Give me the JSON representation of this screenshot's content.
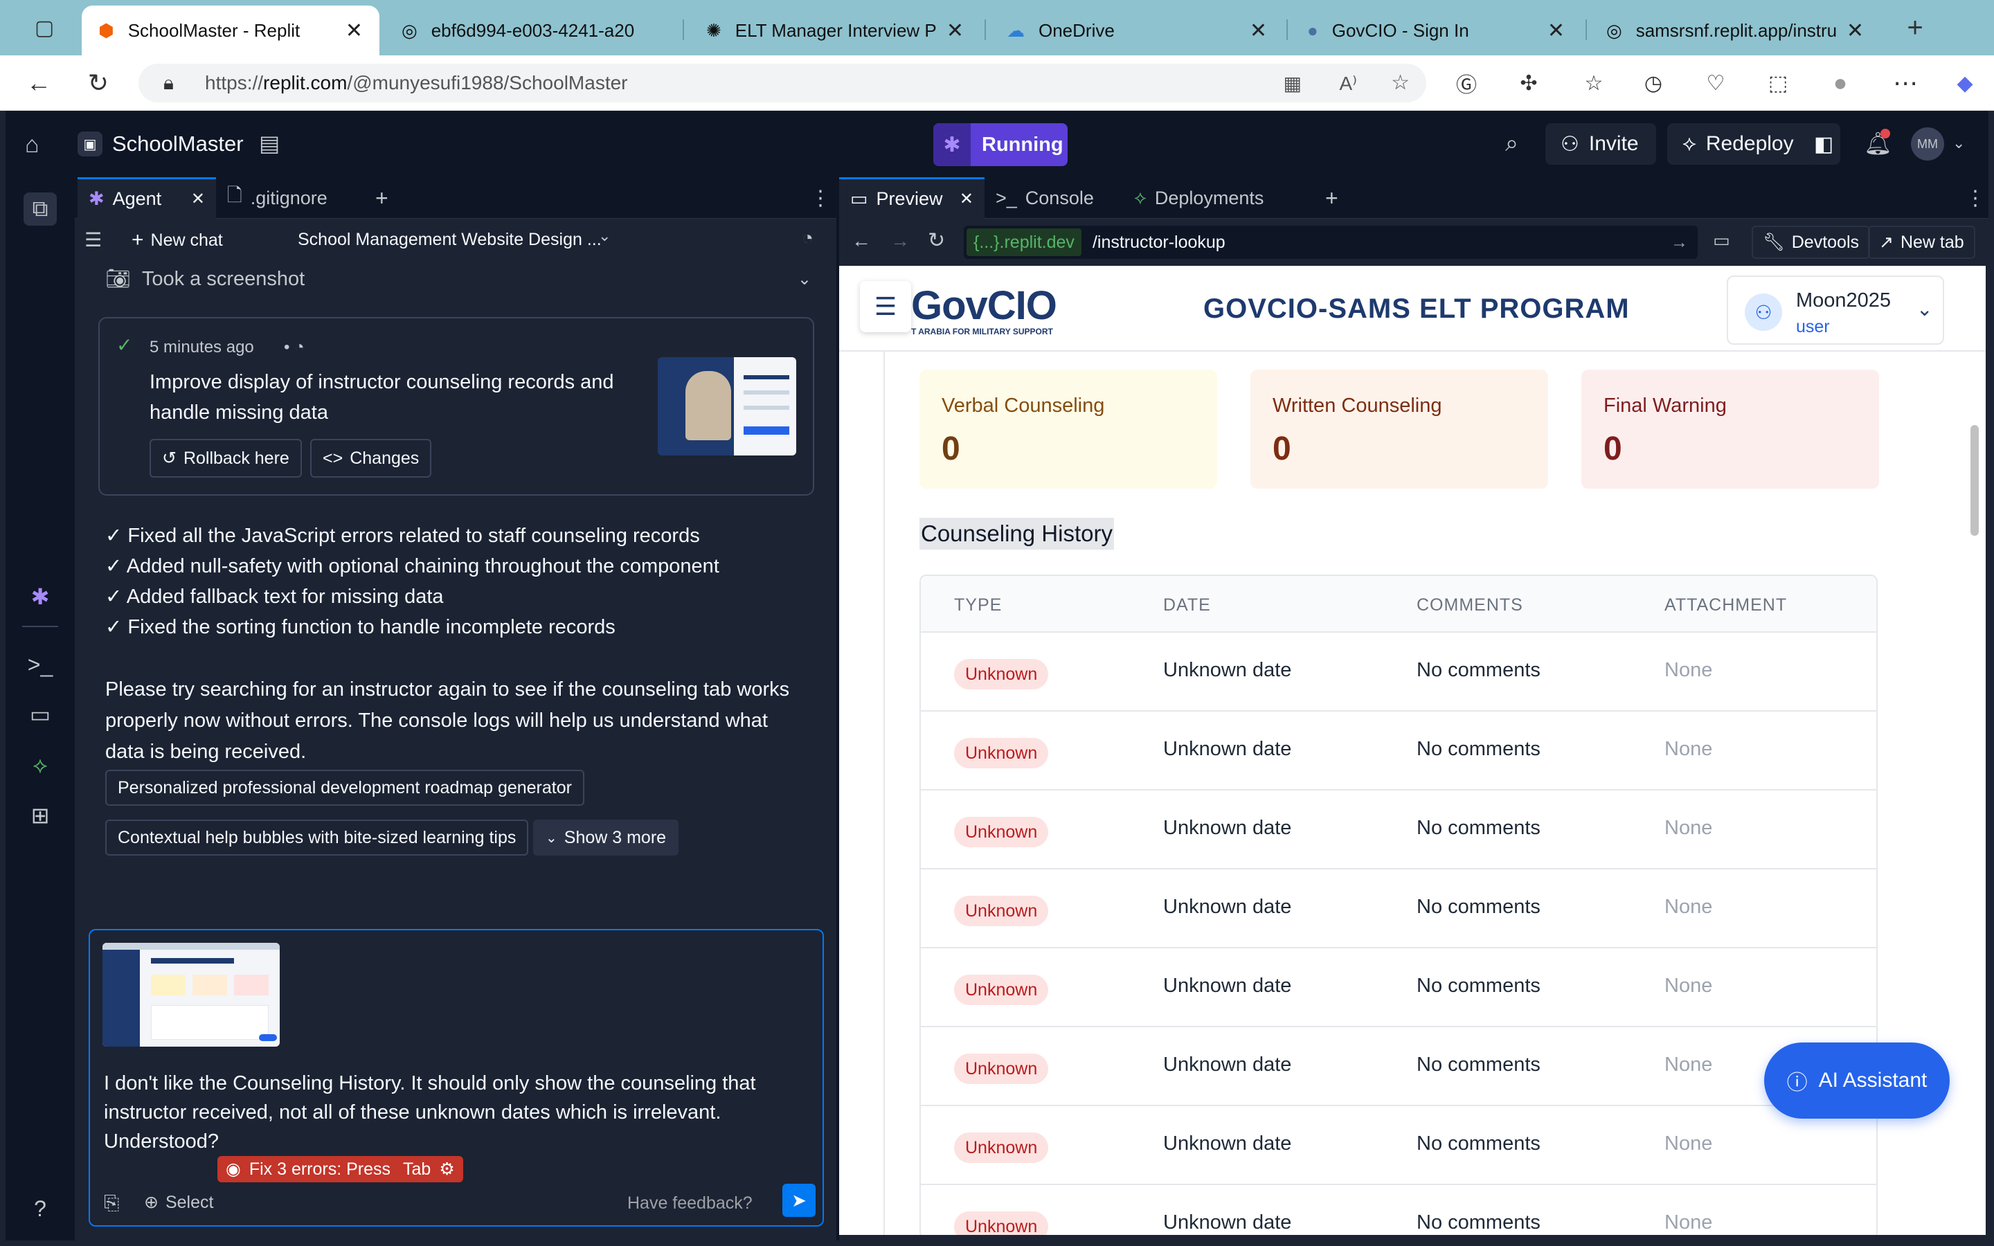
{
  "browser": {
    "tabs": [
      {
        "title": "SchoolMaster - Replit",
        "icon": "replit-icon",
        "active": true
      },
      {
        "title": "ebf6d994-e003-4241-a20",
        "icon": "globe-icon"
      },
      {
        "title": "ELT Manager Interview Prep",
        "icon": "openai-icon"
      },
      {
        "title": "OneDrive",
        "icon": "cloud-icon"
      },
      {
        "title": "GovCIO - Sign In",
        "icon": "circle-icon"
      },
      {
        "title": "samsrsnf.replit.app/instruct",
        "icon": "globe-icon"
      }
    ],
    "url_prefix": "https://",
    "url_host": "replit.com",
    "url_path": "/@munyesufi1988/SchoolMaster"
  },
  "app": {
    "project_name": "SchoolMaster",
    "run_status": "Running",
    "invite_label": "Invite",
    "redeploy_label": "Redeploy",
    "avatar_initials": "MM"
  },
  "agent": {
    "tabs": [
      {
        "label": "Agent"
      },
      {
        "label": ".gitignore"
      }
    ],
    "new_chat_label": "New chat",
    "chat_title": "School Management Website Design ...",
    "screenshot_label": "Took a screenshot",
    "checkpoint": {
      "time": "5 minutes ago",
      "title": "Improve display of instructor counseling records and handle missing data",
      "rollback_label": "Rollback here",
      "changes_label": "Changes"
    },
    "bullets": [
      "✓ Fixed all the JavaScript errors related to staff counseling records",
      "✓ Added null-safety with optional chaining throughout the component",
      "✓ Added fallback text for missing data",
      "✓ Fixed the sorting function to handle incomplete records"
    ],
    "message": "Please try searching for an instructor again to see if the counseling tab works properly now without errors. The console logs will help us understand what data is being received.",
    "suggestions": [
      "Personalized professional development roadmap generator",
      "Contextual help bubbles with bite-sized learning tips"
    ],
    "show_more_label": "Show 3 more",
    "input_text": "I don't like the Counseling History. It should only show the counseling that instructor received, not all of these unknown dates which is irrelevant. Understood?",
    "fix_errors_label": "Fix 3 errors: Press",
    "tab_key_label": "Tab",
    "select_label": "Select",
    "feedback_label": "Have feedback?"
  },
  "preview": {
    "tabs": [
      {
        "label": "Preview"
      },
      {
        "label": "Console"
      },
      {
        "label": "Deployments"
      }
    ],
    "url_domain": "{...}.replit.dev",
    "url_path": "/instructor-lookup",
    "devtools_label": "Devtools",
    "newtab_label": "New tab"
  },
  "site": {
    "logo_text": "GovCIO",
    "logo_sub": "T ARABIA FOR MILITARY SUPPORT",
    "program_title": "GOVCIO-SAMS ELT PROGRAM",
    "user_name": "Moon2025",
    "user_role": "user",
    "stats": [
      {
        "label": "Verbal Counseling",
        "value": "0",
        "bg": "#fefbe8",
        "color": "#854d0e"
      },
      {
        "label": "Written Counseling",
        "value": "0",
        "bg": "#fef3ea",
        "color": "#7c2d12"
      },
      {
        "label": "Final Warning",
        "value": "0",
        "bg": "#fdeeee",
        "color": "#7f1d1d"
      }
    ],
    "history_title": "Counseling History",
    "columns": [
      "TYPE",
      "DATE",
      "COMMENTS",
      "ATTACHMENT"
    ],
    "rows": [
      [
        "Unknown",
        "Unknown date",
        "No comments",
        "None"
      ],
      [
        "Unknown",
        "Unknown date",
        "No comments",
        "None"
      ],
      [
        "Unknown",
        "Unknown date",
        "No comments",
        "None"
      ],
      [
        "Unknown",
        "Unknown date",
        "No comments",
        "None"
      ],
      [
        "Unknown",
        "Unknown date",
        "No comments",
        "None"
      ],
      [
        "Unknown",
        "Unknown date",
        "No comments",
        "None"
      ],
      [
        "Unknown",
        "Unknown date",
        "No comments",
        "None"
      ],
      [
        "Unknown",
        "Unknown date",
        "No comments",
        "None"
      ]
    ],
    "ai_assistant_label": "AI Assistant"
  },
  "colors": {
    "accent": "#0079f2",
    "running": "#5b3fd8",
    "site_navy": "#1e3a6e",
    "ai_button": "#2563eb"
  }
}
